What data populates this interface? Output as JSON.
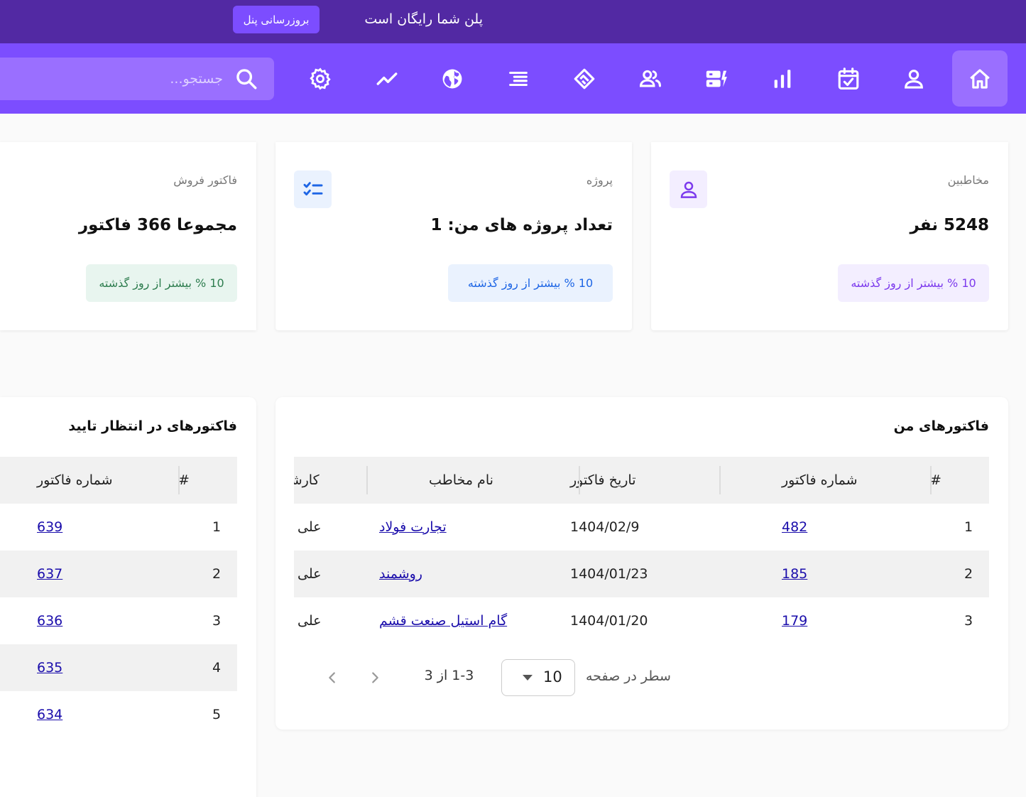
{
  "topbar": {
    "plan_text": "پلن شما رایگان است",
    "upgrade_label": "بروزرسانی پنل"
  },
  "navbar": {
    "search_placeholder": "جستجو...",
    "icons": [
      "home-icon",
      "user-icon",
      "calendar-check-icon",
      "bar-chart-icon",
      "dashboard-icon",
      "users-icon",
      "handshake-icon",
      "menu-lines-icon",
      "globe-icon",
      "trend-line-icon",
      "settings-gear-icon",
      "search-icon"
    ]
  },
  "stats": {
    "contacts": {
      "label": "مخاطبین",
      "value": "5248 نفر",
      "change": "10 % بیشتر از روز گذشته"
    },
    "projects": {
      "label": "پروژه",
      "value": "تعداد پروژه های من: 1",
      "change": "10 % بیشتر از روز گذشته"
    },
    "invoices": {
      "label": "فاکتور فروش",
      "value": "مجموعا 366 فاکتور",
      "change": "10 % بیشتر از روز گذشته"
    }
  },
  "colors": {
    "topbar": "#5229a3",
    "nav": "#7c4dff",
    "purple_badge_bg": "#f3eeff",
    "purple_badge_text": "#7c3aed",
    "blue_badge_bg": "#eaf2fe",
    "blue_badge_text": "#1e66e5",
    "green_badge_bg": "#e8f5ef",
    "green_badge_text": "#2e7d4f",
    "link": "#1a0dab"
  },
  "my_invoices": {
    "title": "فاکتورهای من",
    "columns": [
      "#",
      "شماره فاکتور",
      "تاریخ فاکتور",
      "نام مخاطب",
      "کارشناس"
    ],
    "rows": [
      {
        "idx": "1",
        "number": "482",
        "date": "1404/02/9",
        "contact": "تجارت فولاد",
        "expert": "علی احمد"
      },
      {
        "idx": "2",
        "number": "185",
        "date": "1404/01/23",
        "contact": "روشمند",
        "expert": "علی احمد"
      },
      {
        "idx": "3",
        "number": "179",
        "date": "1404/01/20",
        "contact": "گام استیل صنعت قشم",
        "expert": "علی احمد"
      }
    ],
    "pagination": {
      "rows_label": "سطر در صفحه",
      "rows_per_page": "10",
      "range": "1-3 از 3"
    }
  },
  "pending_invoices": {
    "title": "فاکتورهای در انتظار تایید",
    "columns": [
      "#",
      "شماره فاکتور"
    ],
    "rows": [
      {
        "idx": "1",
        "number": "639"
      },
      {
        "idx": "2",
        "number": "637"
      },
      {
        "idx": "3",
        "number": "636"
      },
      {
        "idx": "4",
        "number": "635"
      },
      {
        "idx": "5",
        "number": "634"
      }
    ]
  }
}
